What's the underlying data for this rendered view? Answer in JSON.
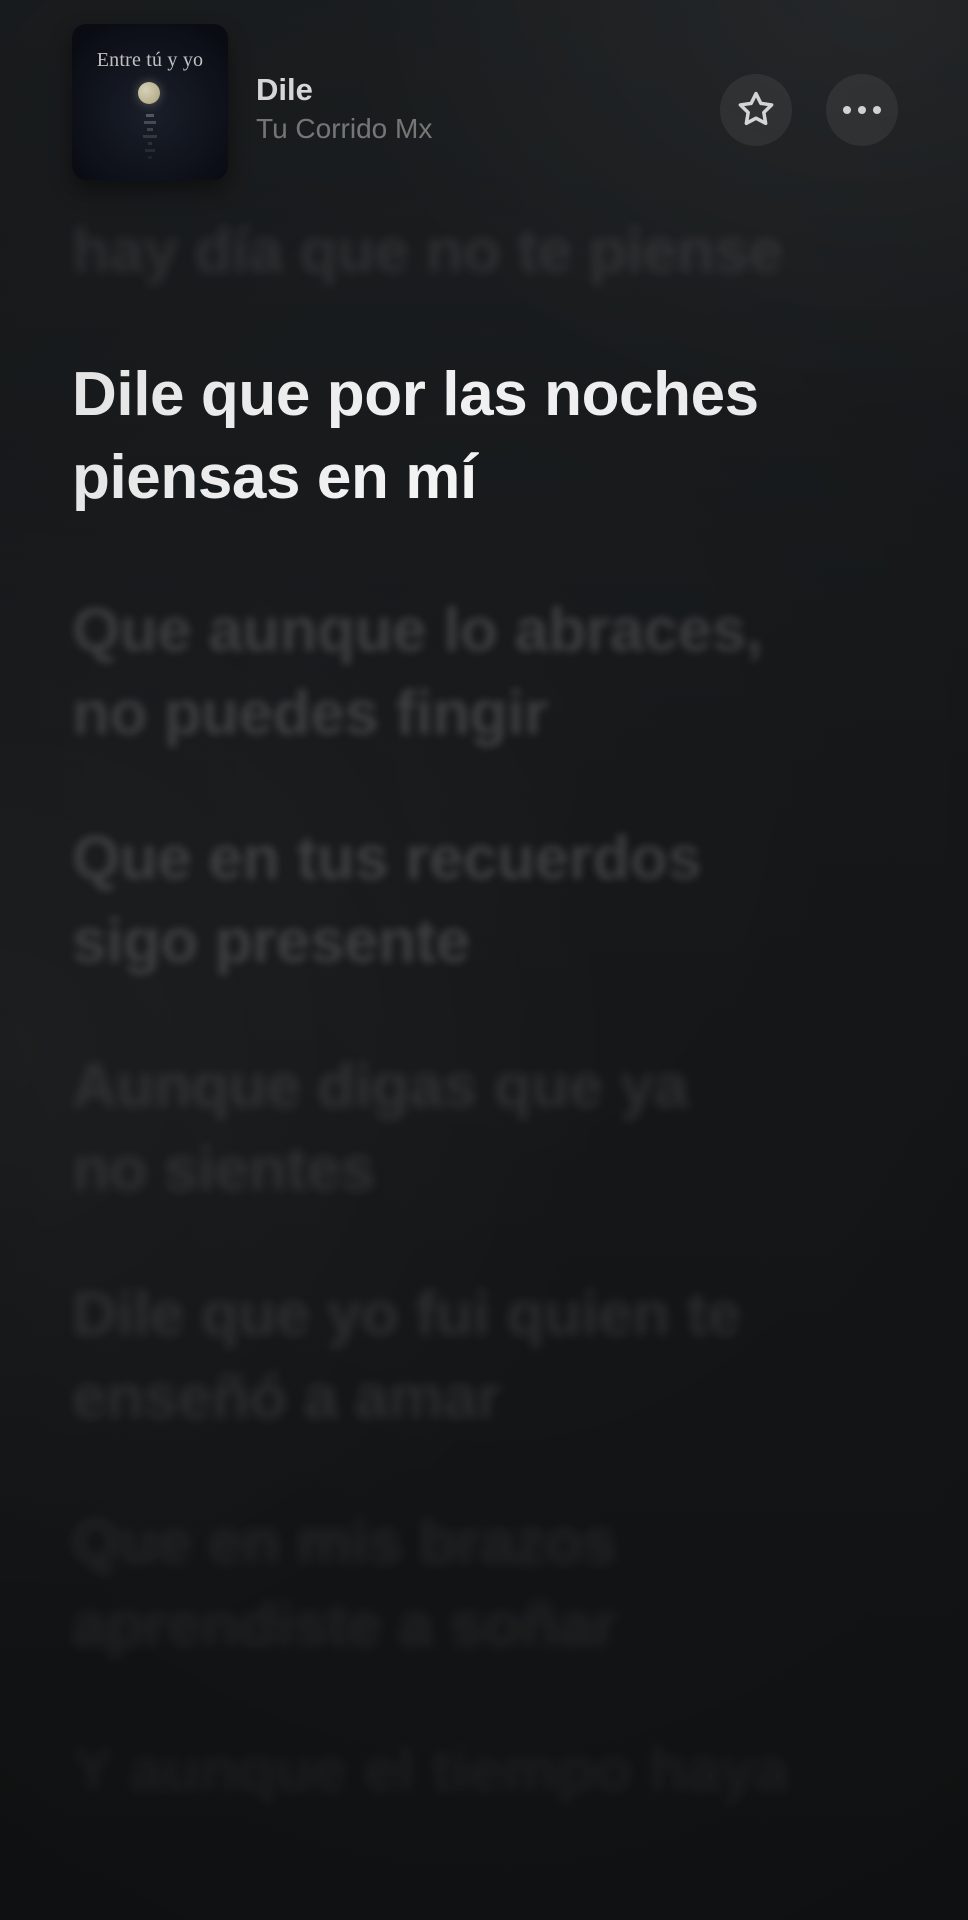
{
  "now_playing": {
    "album_art_text": "Entre tú y yo",
    "title": "Dile",
    "artist": "Tu Corrido Mx"
  },
  "actions": {
    "favorite_icon": "star-icon",
    "more_icon": "more-icon"
  },
  "lyrics": [
    {
      "text": "hay día que no te piense",
      "state": "previous-partial"
    },
    {
      "text": "Dile que por las noches\npiensas en mí",
      "state": "current"
    },
    {
      "text": "Que aunque lo abraces,\nno puedes fingir",
      "state": "upcoming"
    },
    {
      "text": "Que en tus recuerdos\nsigo presente",
      "state": "upcoming"
    },
    {
      "text": "Aunque digas que ya\nno sientes",
      "state": "upcoming"
    },
    {
      "text": "Dile que yo fui quien te\nenseñó a amar",
      "state": "upcoming"
    },
    {
      "text": "Que en mis brazos\naprendiste a soñar",
      "state": "upcoming"
    },
    {
      "text": "Y aunque el tiempo haya",
      "state": "upcoming-partial"
    }
  ]
}
